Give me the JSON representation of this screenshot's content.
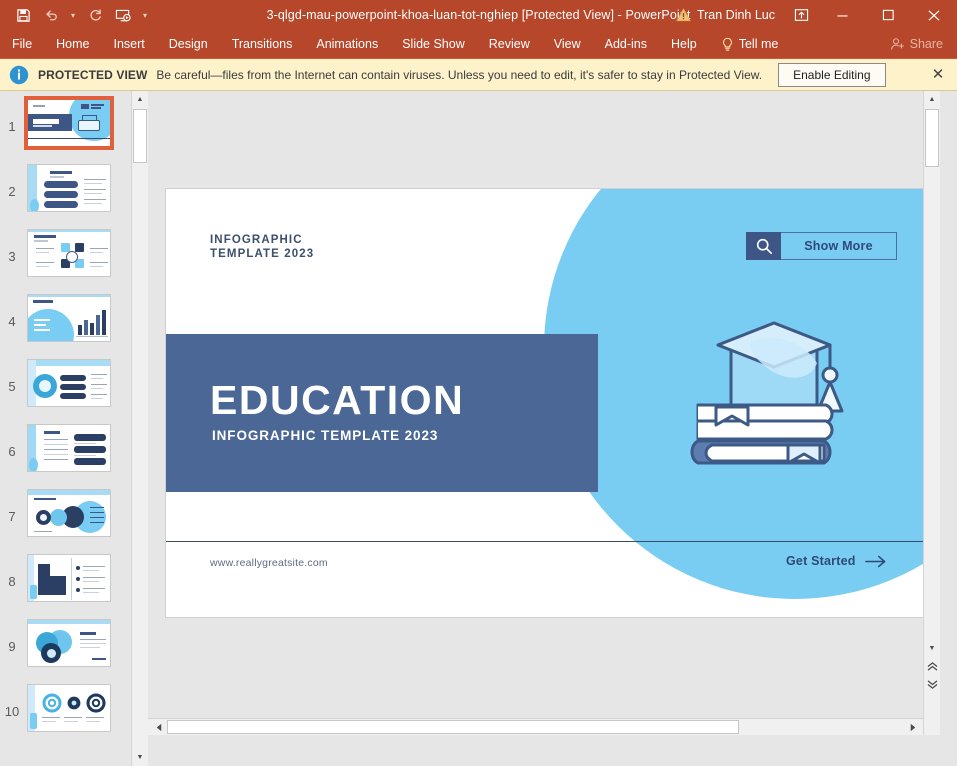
{
  "titlebar": {
    "document_title": "3-qlgd-mau-powerpoint-khoa-luan-tot-nghiep [Protected View]  -  PowerPoint",
    "account_name": "Tran Dinh Luc",
    "quick_access": [
      {
        "name": "save-button",
        "label": "Save"
      },
      {
        "name": "undo-button",
        "label": "Undo"
      },
      {
        "name": "redo-button",
        "label": "Redo"
      },
      {
        "name": "start-presentation-button",
        "label": "Start From Beginning"
      },
      {
        "name": "customize-quick-access-toolbar",
        "label": "Customize Quick Access Toolbar"
      }
    ],
    "window_controls": {
      "ribbon_display_options": "Ribbon Display Options",
      "minimize": "—",
      "maximize": "☐",
      "close": "✕"
    },
    "accent_color": "#b7472a"
  },
  "ribbon": {
    "tabs": [
      "File",
      "Home",
      "Insert",
      "Design",
      "Transitions",
      "Animations",
      "Slide Show",
      "Review",
      "View",
      "Add-ins",
      "Help"
    ],
    "tell_me": "Tell me",
    "share": "Share"
  },
  "protected_view": {
    "label": "PROTECTED VIEW",
    "message": "Be careful—files from the Internet can contain viruses. Unless you need to edit, it's safer to stay in Protected View.",
    "enable_button": "Enable Editing",
    "close": "✕",
    "background_color": "#fdf2ca"
  },
  "thumbnails": {
    "slides": [
      {
        "number": "1",
        "selected": true
      },
      {
        "number": "2",
        "selected": false
      },
      {
        "number": "3",
        "selected": false
      },
      {
        "number": "4",
        "selected": false
      },
      {
        "number": "5",
        "selected": false
      },
      {
        "number": "6",
        "selected": false
      },
      {
        "number": "7",
        "selected": false
      },
      {
        "number": "8",
        "selected": false
      },
      {
        "number": "9",
        "selected": false
      },
      {
        "number": "10",
        "selected": false
      }
    ]
  },
  "slide": {
    "kicker_line1": "INFOGRAPHIC",
    "kicker_line2": "TEMPLATE 2023",
    "title": "EDUCATION",
    "subtitle": "INFOGRAPHIC TEMPLATE 2023",
    "website": "www.reallygreatsite.com",
    "cta_label": "Get Started",
    "cta_arrow": "→",
    "show_more_label": "Show More",
    "colors": {
      "circle": "#79cdf2",
      "band": "#4a6795",
      "title_text": "#ffffff",
      "kicker_text": "#3c4f6b",
      "cta_text": "#2e4a72"
    }
  },
  "scrollbars": {
    "vertical_up": "▲",
    "vertical_down": "▼",
    "previous_slide": "⥣",
    "next_slide": "⥥",
    "horizontal_left": "◀",
    "horizontal_right": "▶"
  }
}
